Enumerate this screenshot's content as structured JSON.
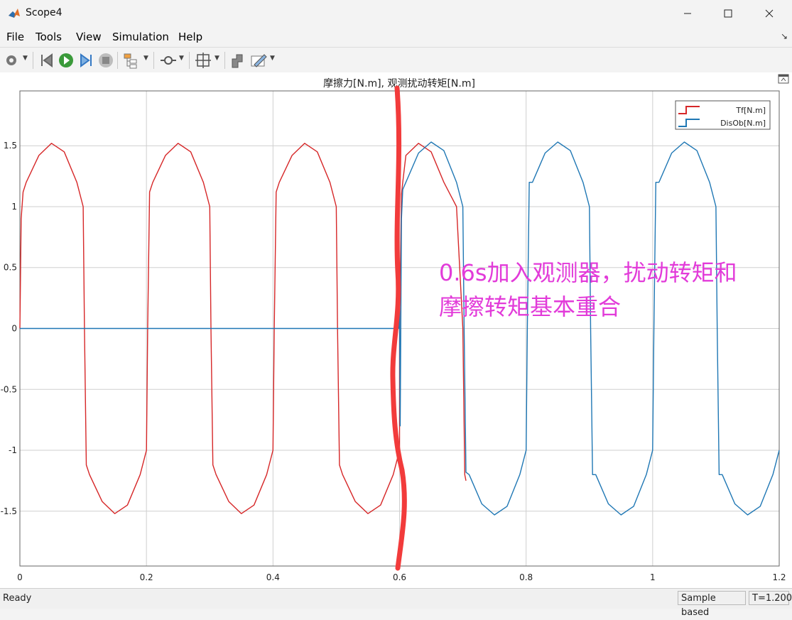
{
  "window": {
    "title": "Scope4"
  },
  "menu": [
    "File",
    "Tools",
    "View",
    "Simulation",
    "Help"
  ],
  "toolbar_icons": [
    "gear-icon",
    "step-back-icon",
    "run-icon",
    "step-forward-icon",
    "stop-icon",
    "signal-hierarchy-icon",
    "zoom-icon",
    "autoscale-icon",
    "highlight-block-icon",
    "style-icon"
  ],
  "colors": {
    "tf": "#d62728",
    "disob": "#1f77b4",
    "annotation": "#e23bd9",
    "marker": "#f23b3b"
  },
  "chart_data": {
    "type": "line",
    "title": "摩擦力[N.m], 观测扰动转矩[N.m]",
    "xlim": [
      0,
      1.2
    ],
    "ylim": [
      -1.95,
      1.95
    ],
    "xticks": [
      "0",
      "0.2",
      "0.4",
      "0.6",
      "0.8",
      "1",
      "1.2"
    ],
    "yticks": [
      "1.5",
      "1",
      "0.5",
      "0",
      "-0.5",
      "-1",
      "-1.5"
    ],
    "grid": true,
    "legend_position": "top-right",
    "series": [
      {
        "name": "Tf[N.m]",
        "color": "#d62728",
        "x": [
          0,
          0.002,
          0.005,
          0.01,
          0.03,
          0.05,
          0.07,
          0.09,
          0.1,
          0.102,
          0.105,
          0.11,
          0.13,
          0.15,
          0.17,
          0.19,
          0.2,
          0.202,
          0.205,
          0.21,
          0.23,
          0.25,
          0.27,
          0.29,
          0.3,
          0.302,
          0.305,
          0.31,
          0.33,
          0.35,
          0.37,
          0.39,
          0.4,
          0.402,
          0.405,
          0.41,
          0.43,
          0.45,
          0.47,
          0.49,
          0.5,
          0.502,
          0.505,
          0.51,
          0.53,
          0.55,
          0.57,
          0.59,
          0.6,
          0.6,
          0.603,
          0.605,
          0.61,
          0.63,
          0.65,
          0.67,
          0.69,
          0.7,
          0.703,
          0.705
        ],
        "y": [
          0,
          0.9,
          1.12,
          1.2,
          1.42,
          1.52,
          1.45,
          1.2,
          1.0,
          0,
          -1.12,
          -1.2,
          -1.42,
          -1.52,
          -1.45,
          -1.2,
          -1.0,
          0,
          1.12,
          1.2,
          1.42,
          1.52,
          1.45,
          1.2,
          1.0,
          0,
          -1.12,
          -1.2,
          -1.42,
          -1.52,
          -1.45,
          -1.2,
          -1.0,
          0,
          1.12,
          1.2,
          1.42,
          1.52,
          1.45,
          1.2,
          1.0,
          0,
          -1.12,
          -1.2,
          -1.42,
          -1.52,
          -1.45,
          -1.2,
          -1.0,
          0,
          1.1,
          1.2,
          1.42,
          1.52,
          1.45,
          1.2,
          1.0,
          0,
          -1.2,
          -1.25
        ]
      },
      {
        "name": "DisOb[N.m]",
        "color": "#1f77b4",
        "x": [
          0,
          0.599,
          0.6,
          0.601,
          0.603,
          0.605,
          0.61,
          0.63,
          0.65,
          0.67,
          0.69,
          0.7,
          0.702,
          0.705,
          0.71,
          0.73,
          0.75,
          0.77,
          0.79,
          0.8,
          0.802,
          0.805,
          0.81,
          0.83,
          0.85,
          0.87,
          0.89,
          0.9,
          0.902,
          0.905,
          0.91,
          0.93,
          0.95,
          0.97,
          0.99,
          1.0,
          1.002,
          1.005,
          1.01,
          1.03,
          1.05,
          1.07,
          1.09,
          1.1,
          1.102,
          1.105,
          1.11,
          1.13,
          1.15,
          1.17,
          1.19,
          1.2
        ],
        "y": [
          0,
          0,
          0.15,
          -0.8,
          0.9,
          1.14,
          1.2,
          1.44,
          1.53,
          1.46,
          1.2,
          1.0,
          0,
          -1.18,
          -1.2,
          -1.44,
          -1.53,
          -1.46,
          -1.2,
          -1.0,
          0,
          1.2,
          1.2,
          1.44,
          1.53,
          1.46,
          1.2,
          1.0,
          0,
          -1.2,
          -1.2,
          -1.44,
          -1.53,
          -1.46,
          -1.2,
          -1.0,
          0,
          1.2,
          1.2,
          1.44,
          1.53,
          1.46,
          1.2,
          1.0,
          0,
          -1.2,
          -1.2,
          -1.44,
          -1.53,
          -1.46,
          -1.2,
          -1.0
        ]
      }
    ],
    "annotations": [
      "0.6s加入观测器，扰动转矩和",
      "摩擦转矩基本重合"
    ]
  },
  "status": {
    "left": "Ready",
    "mode": "Sample based",
    "time": "T=1.200"
  }
}
